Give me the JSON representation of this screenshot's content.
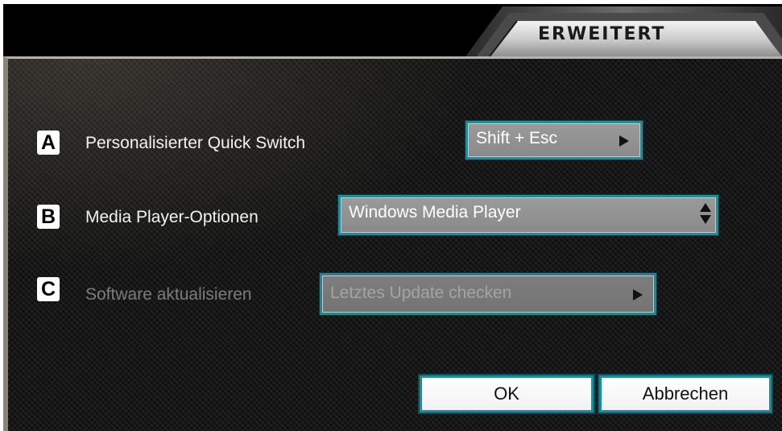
{
  "window": {
    "tab_title": "ERWEITERT"
  },
  "settings": [
    {
      "badge": "A",
      "label": "Personalisierter Quick Switch",
      "control_type": "button",
      "value": "Shift + Esc",
      "enabled": true,
      "icon": "play-arrow-icon"
    },
    {
      "badge": "B",
      "label": "Media Player-Optionen",
      "control_type": "select",
      "value": "Windows Media Player",
      "enabled": true,
      "icon": "spinner-updown-icon"
    },
    {
      "badge": "C",
      "label": "Software aktualisieren",
      "control_type": "button",
      "value": "Letztes Update checken",
      "enabled": false,
      "icon": "play-arrow-icon"
    }
  ],
  "buttons": {
    "ok": "OK",
    "cancel": "Abbrechen"
  },
  "colors": {
    "accent_border": "#1f8c9a",
    "panel_background": "#161616",
    "enabled_text": "#f2f2f2",
    "disabled_text": "#7c7c7c"
  }
}
